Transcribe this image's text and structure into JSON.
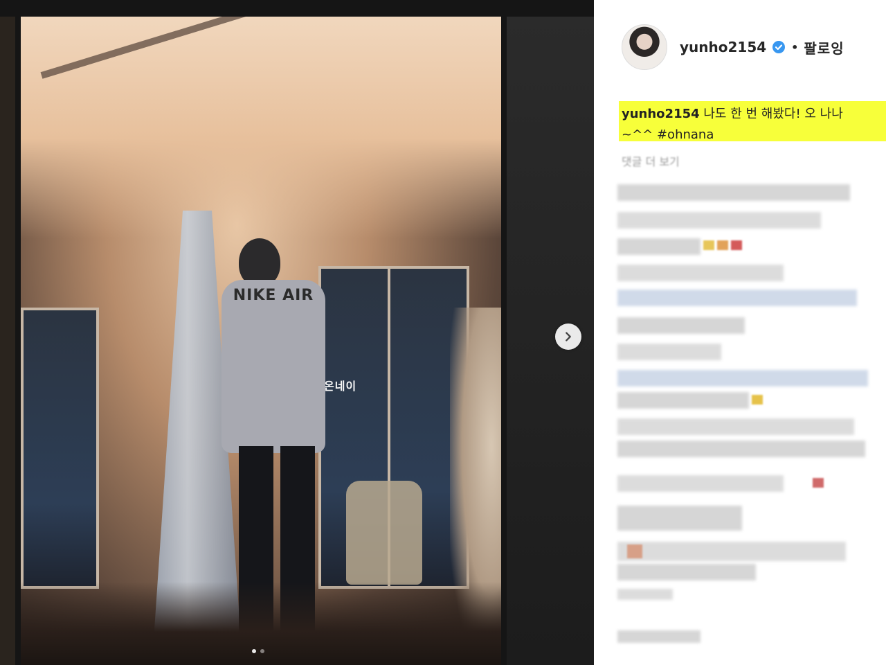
{
  "post": {
    "username": "yunho2154",
    "verified_icon": "verified-check-icon",
    "separator": "•",
    "follow_label": "팔로잉",
    "caption": {
      "user": "yunho2154",
      "text_line1": " 나도 한 번 해봤다! 오 나나",
      "text_line2": "~^^ #ohnana"
    },
    "more_comments": "댓글 더 보기",
    "media": {
      "sweater_text": "NIKE AIR",
      "shop_sign": "온네이",
      "next_icon": "chevron-right-icon",
      "carousel_dots": 2
    }
  },
  "colors": {
    "highlight": "#f7ff3a",
    "verified": "#3897f0"
  }
}
